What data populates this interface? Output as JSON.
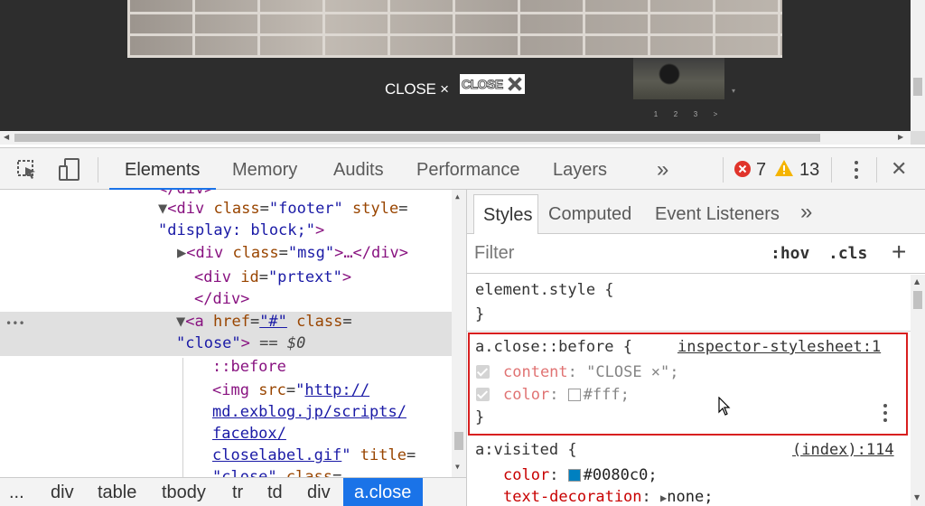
{
  "preview": {
    "close_text": "CLOSE ×",
    "close_image_label": "CLOSE",
    "pager": [
      "1",
      "2",
      "3",
      ">"
    ],
    "thumb_arrow": "▾"
  },
  "toolbar": {
    "tabs": [
      "Elements",
      "Memory",
      "Audits",
      "Performance",
      "Layers"
    ],
    "more": "»",
    "errors": "7",
    "warnings": "13",
    "close": "✕"
  },
  "elements": {
    "lines": {
      "l0": "</div>",
      "l1_tag": "<div",
      "l1_attr": "class",
      "l1_val": "\"footer\"",
      "l1_attr2": "style",
      "l2_val": "\"display: block;\"",
      "l3_tag": "<div",
      "l3_attr": "class",
      "l3_val": "\"msg\"",
      "l3_rest": ">…</div>",
      "l4_tag": "<div",
      "l4_attr": "id",
      "l4_val": "\"prtext\"",
      "l5": "</div>",
      "l6_tag": "<a",
      "l6_attr": "href",
      "l6_val": "\"#\"",
      "l6_attr2": "class",
      "l7_val": "\"close\"",
      "l7_rest": "== $0",
      "l8": "::before",
      "l9_tag": "<img",
      "l9_attr": "src",
      "l9_val": "http://",
      "l10": "md.exblog.jp/scripts/",
      "l11": "facebox/",
      "l12": "closelabel.gif",
      "l12_attr": "title",
      "l13_val": "\"close\"",
      "l13_attr": "class"
    },
    "gutter_ellipsis": "•••"
  },
  "breadcrumb": {
    "more": "...",
    "items": [
      "div",
      "table",
      "tbody",
      "tr",
      "td",
      "div"
    ],
    "active": "a.close"
  },
  "styles": {
    "tabs": [
      "Styles",
      "Computed",
      "Event Listeners"
    ],
    "more": "»",
    "filter_placeholder": "Filter",
    "hov": ":hov",
    "cls": ".cls",
    "add": "+",
    "rules": {
      "element_style": "element.style {",
      "element_style_close": "}",
      "before_selector": "a.close::before {",
      "before_source": "inspector-stylesheet:1",
      "before_prop1": "content",
      "before_val1": "\"CLOSE ×\";",
      "before_prop2": "color",
      "before_val2": "#fff;",
      "before_close": "}",
      "visited_selector": "a:visited {",
      "visited_source": "(index):114",
      "visited_prop1": "color",
      "visited_val1": "#0080c0;",
      "visited_prop2": "text-decoration",
      "visited_val2": "none;"
    },
    "colors": {
      "white_swatch": "#ffffff",
      "blue_swatch": "#0080c0"
    }
  }
}
